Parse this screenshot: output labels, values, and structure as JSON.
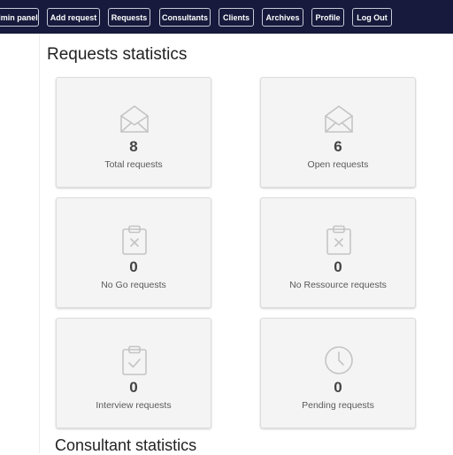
{
  "nav": {
    "items": [
      {
        "label": "dmin panel"
      },
      {
        "label": "Add request"
      },
      {
        "label": "Requests"
      },
      {
        "label": "Consultants"
      },
      {
        "label": "Clients"
      },
      {
        "label": "Archives"
      },
      {
        "label": "Profile"
      },
      {
        "label": "Log Out"
      }
    ]
  },
  "main": {
    "title": "Requests statistics",
    "cards": [
      {
        "value": "8",
        "label": "Total requests",
        "icon": "envelope-open-icon"
      },
      {
        "value": "6",
        "label": "Open requests",
        "icon": "envelope-open-icon"
      },
      {
        "value": "0",
        "label": "No Go requests",
        "icon": "clipboard-x-icon"
      },
      {
        "value": "0",
        "label": "No Ressource requests",
        "icon": "clipboard-x-icon"
      },
      {
        "value": "0",
        "label": "Interview requests",
        "icon": "clipboard-check-icon"
      },
      {
        "value": "0",
        "label": "Pending requests",
        "icon": "clock-icon"
      }
    ],
    "consultant_title": "Consultant statistics"
  },
  "colors": {
    "navbar": "#171a3c",
    "card_bg": "#f4f4f4",
    "icon": "#c4c4c4"
  }
}
